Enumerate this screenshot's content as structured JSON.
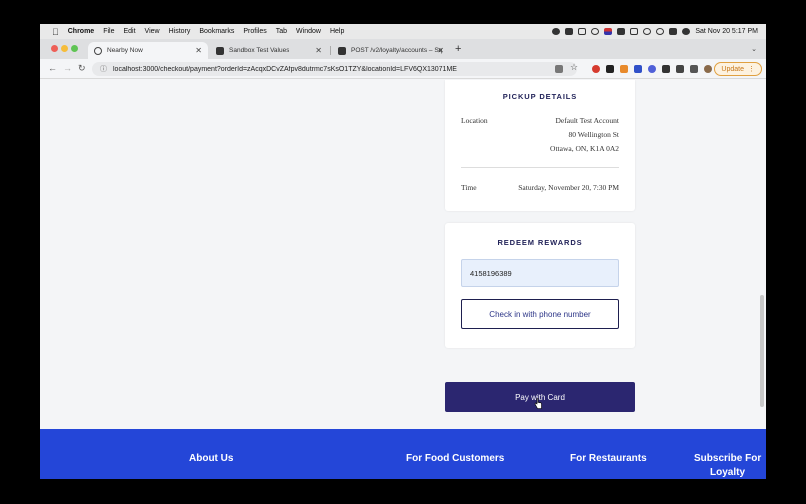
{
  "menubar": {
    "app": "Chrome",
    "items": [
      "File",
      "Edit",
      "View",
      "History",
      "Bookmarks",
      "Profiles",
      "Tab",
      "Window",
      "Help"
    ],
    "clock": "Sat Nov 20  5:17 PM"
  },
  "tabs": [
    {
      "title": "Nearby Now",
      "icon": "globe-icon"
    },
    {
      "title": "Sandbox Test Values",
      "icon": "square-logo-icon"
    },
    {
      "title": "POST /v2/loyalty/accounts – Sq",
      "icon": "square-logo-icon"
    }
  ],
  "address": {
    "url": "localhost:3000/checkout/payment?orderId=zAcqxDCvZAfpv8dutrmc7sKsO1TZY&locationId=LFV6QX13071ME",
    "update_label": "Update"
  },
  "pickup": {
    "title": "PICKUP DETAILS",
    "location_label": "Location",
    "location_lines": [
      "Default Test Account",
      "80 Wellington St",
      "Ottawa, ON, K1A 0A2"
    ],
    "time_label": "Time",
    "time_value": "Saturday, November 20, 7:30 PM"
  },
  "rewards": {
    "title": "REDEEM REWARDS",
    "phone_value": "4158196389",
    "checkin_label": "Check in with phone number"
  },
  "pay": {
    "label": "Pay with Card"
  },
  "footer": {
    "about": "About Us",
    "food_customers": "For Food Customers",
    "restaurants": "For Restaurants",
    "subscribe_line1": "Subscribe For",
    "subscribe_line2": "Loyalty"
  },
  "colors": {
    "primary": "#2b2670",
    "footer": "#2446d8",
    "input_bg": "#e8f0fc"
  }
}
